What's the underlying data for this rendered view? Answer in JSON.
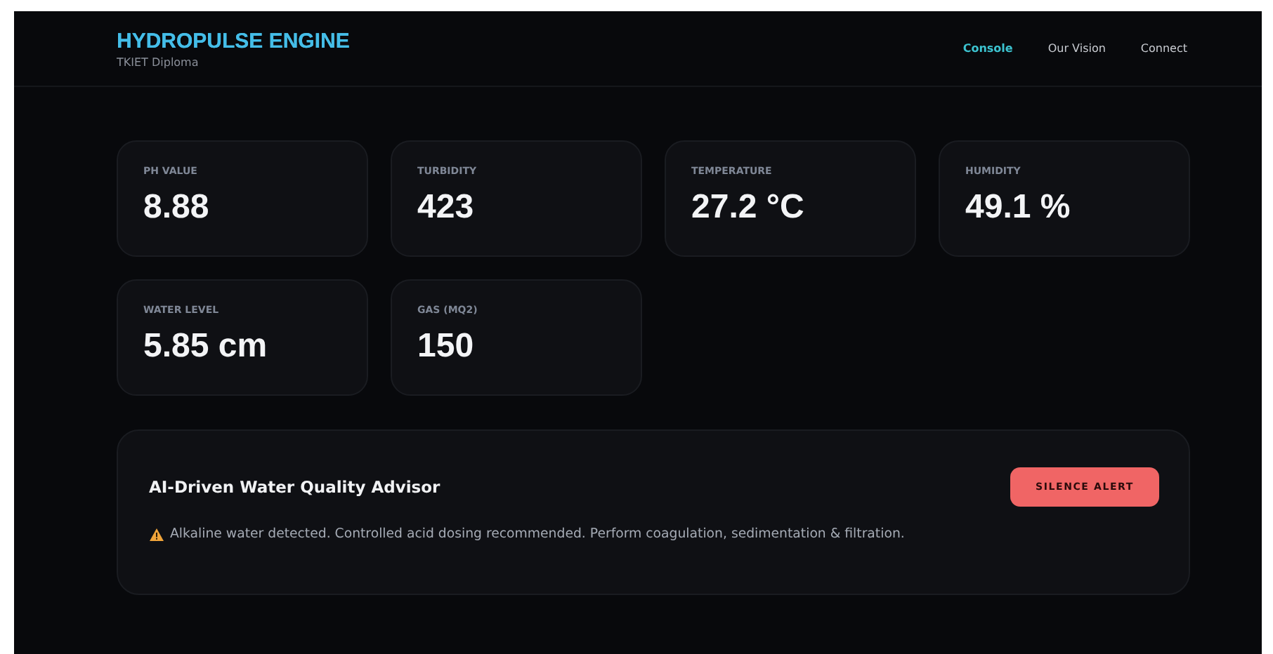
{
  "brand": {
    "title": "HYDROPULSE ENGINE",
    "subtitle": "TKIET Diploma"
  },
  "nav": [
    {
      "label": "Console",
      "selected": true
    },
    {
      "label": "Our Vision",
      "selected": false
    },
    {
      "label": "Connect",
      "selected": false
    }
  ],
  "metrics": [
    {
      "label": "PH VALUE",
      "value": "8.88"
    },
    {
      "label": "TURBIDITY",
      "value": "423"
    },
    {
      "label": "TEMPERATURE",
      "value": "27.2 °C"
    },
    {
      "label": "HUMIDITY",
      "value": "49.1 %"
    },
    {
      "label": "WATER LEVEL",
      "value": "5.85 cm"
    },
    {
      "label": "GAS (MQ2)",
      "value": "150"
    }
  ],
  "advisor": {
    "title": "AI-Driven Water Quality Advisor",
    "button": "SILENCE ALERT",
    "message": "Alkaline water detected. Controlled acid dosing recommended. Perform coagulation, sedimentation & filtration."
  }
}
